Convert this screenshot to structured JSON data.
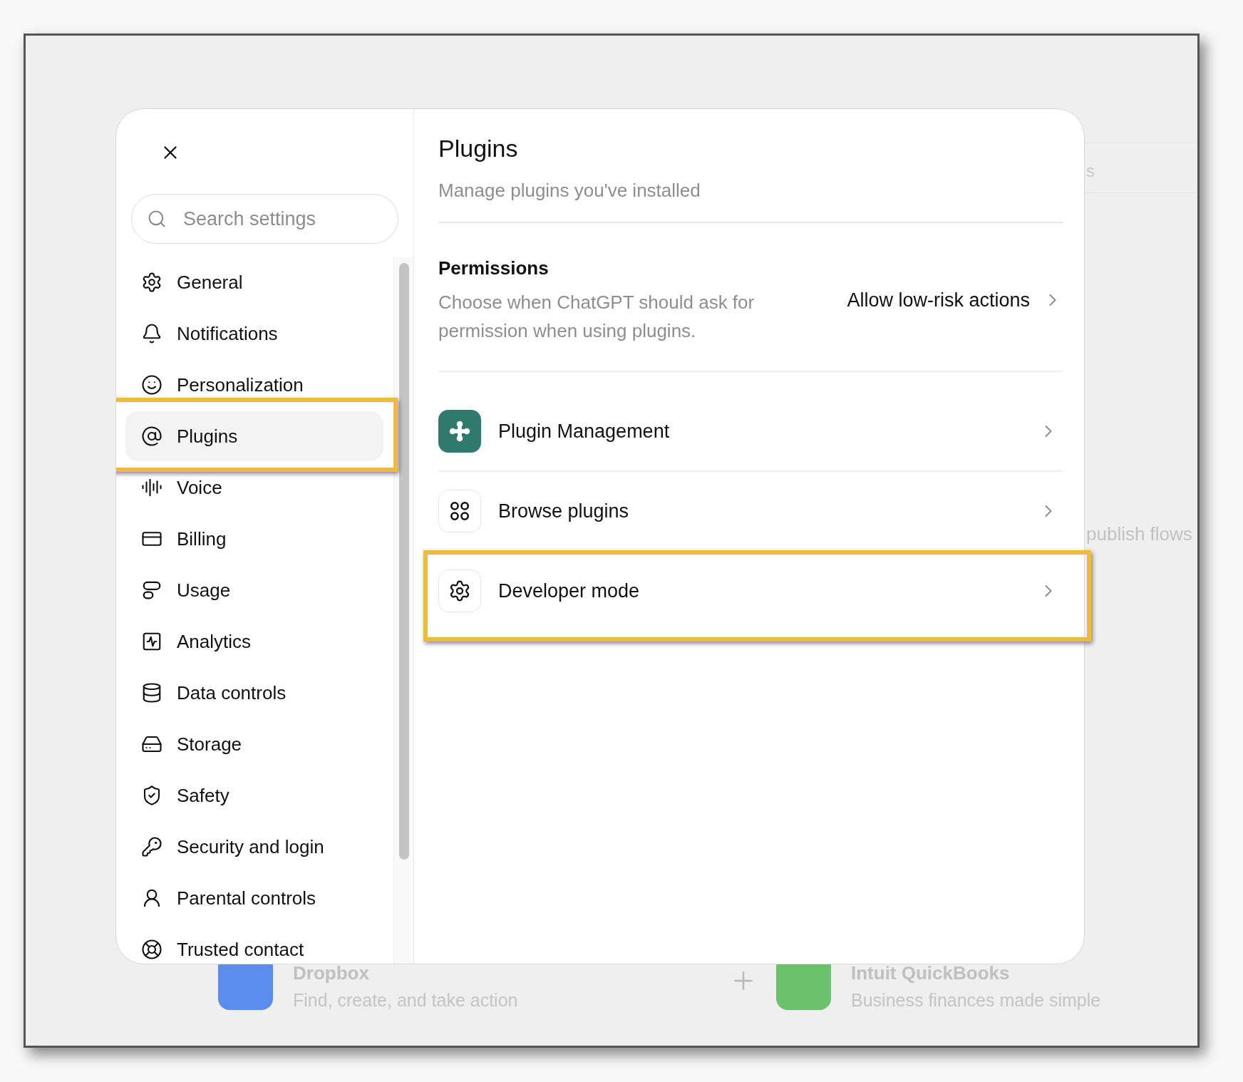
{
  "background": {
    "partial_text": "s",
    "side_text": "publish flows",
    "apps": [
      {
        "name": "Dropbox",
        "description": "Find, create, and take action",
        "color": "#5b8def"
      },
      {
        "name": "Intuit QuickBooks",
        "description": "Business finances made simple",
        "color": "#6cc26a"
      }
    ]
  },
  "settings": {
    "search": {
      "placeholder": "Search settings"
    },
    "sidebar": {
      "items": [
        {
          "label": "General",
          "selected": false,
          "highlighted": false
        },
        {
          "label": "Notifications",
          "selected": false,
          "highlighted": false
        },
        {
          "label": "Personalization",
          "selected": false,
          "highlighted": false
        },
        {
          "label": "Plugins",
          "selected": true,
          "highlighted": true
        },
        {
          "label": "Voice",
          "selected": false,
          "highlighted": false
        },
        {
          "label": "Billing",
          "selected": false,
          "highlighted": false
        },
        {
          "label": "Usage",
          "selected": false,
          "highlighted": false
        },
        {
          "label": "Analytics",
          "selected": false,
          "highlighted": false
        },
        {
          "label": "Data controls",
          "selected": false,
          "highlighted": false
        },
        {
          "label": "Storage",
          "selected": false,
          "highlighted": false
        },
        {
          "label": "Safety",
          "selected": false,
          "highlighted": false
        },
        {
          "label": "Security and login",
          "selected": false,
          "highlighted": false
        },
        {
          "label": "Parental controls",
          "selected": false,
          "highlighted": false
        },
        {
          "label": "Trusted contact",
          "selected": false,
          "highlighted": false
        }
      ]
    },
    "panel": {
      "title": "Plugins",
      "subtitle": "Manage plugins you've installed",
      "permissions": {
        "heading": "Permissions",
        "description": "Choose when ChatGPT should ask for permission when using plugins.",
        "value": "Allow low-risk actions"
      },
      "rows": [
        {
          "label": "Plugin Management",
          "kind": "management",
          "highlighted": false
        },
        {
          "label": "Browse plugins",
          "kind": "browse",
          "highlighted": false
        },
        {
          "label": "Developer mode",
          "kind": "developer",
          "highlighted": true
        }
      ]
    }
  }
}
